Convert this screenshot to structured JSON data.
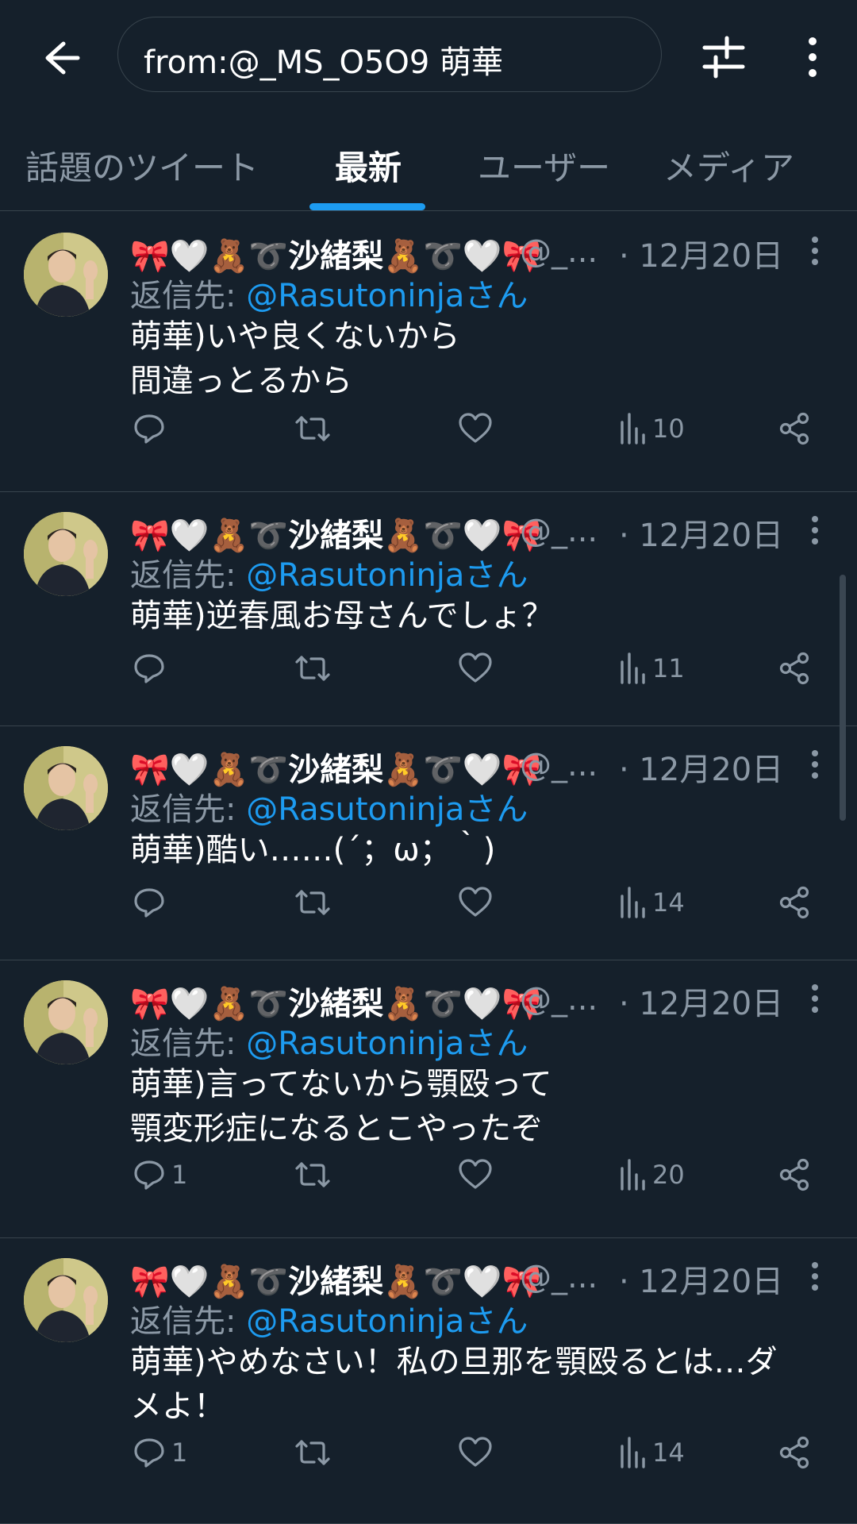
{
  "search": {
    "query": "from:@_MS_O5O9 萌華"
  },
  "tabs": [
    {
      "label": "話題のツイート"
    },
    {
      "label": "最新"
    },
    {
      "label": "ユーザー"
    },
    {
      "label": "メディア"
    }
  ],
  "colors": {
    "background": "#15202b",
    "accent": "#1d9bf0",
    "muted": "#8b98a5",
    "divider": "#38444d"
  },
  "tweets": [
    {
      "name": "🎀🤍🧸➰沙緒梨🧸➰🤍🎀",
      "handle": "@_...",
      "date": "· 12月20日",
      "reply_prefix": "返信先: ",
      "reply_to": "@Rasutoninjaさん",
      "text": "萌華)いや良くないから\n間違っとるから",
      "replies": "",
      "views": "10"
    },
    {
      "name": "🎀🤍🧸➰沙緒梨🧸➰🤍🎀",
      "handle": "@_...",
      "date": "· 12月20日",
      "reply_prefix": "返信先: ",
      "reply_to": "@Rasutoninjaさん",
      "text": "萌華)逆春風お母さんでしょ？",
      "replies": "",
      "views": "11"
    },
    {
      "name": "🎀🤍🧸➰沙緒梨🧸➰🤍🎀",
      "handle": "@_...",
      "date": "· 12月20日",
      "reply_prefix": "返信先: ",
      "reply_to": "@Rasutoninjaさん",
      "text": "萌華)酷い……(´；ω；｀)",
      "replies": "",
      "views": "14"
    },
    {
      "name": "🎀🤍🧸➰沙緒梨🧸➰🤍🎀",
      "handle": "@_...",
      "date": "· 12月20日",
      "reply_prefix": "返信先: ",
      "reply_to": "@Rasutoninjaさん",
      "text": "萌華)言ってないから顎殴って\n顎変形症になるとこやったぞ",
      "replies": "1",
      "views": "20"
    },
    {
      "name": "🎀🤍🧸➰沙緒梨🧸➰🤍🎀",
      "handle": "@_...",
      "date": "· 12月20日",
      "reply_prefix": "返信先: ",
      "reply_to": "@Rasutoninjaさん",
      "text": "萌華)やめなさい！私の旦那を顎殴るとは…ダ\nメよ！",
      "replies": "1",
      "views": "14"
    }
  ]
}
